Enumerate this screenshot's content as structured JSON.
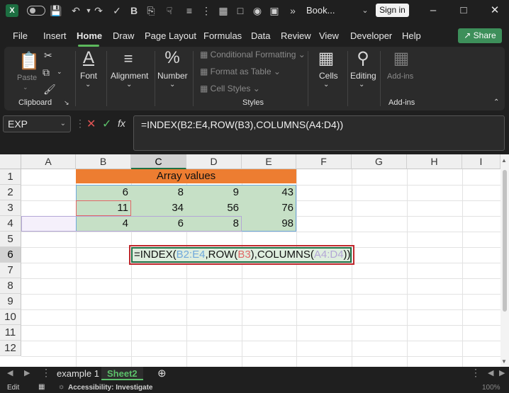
{
  "titlebar": {
    "doc_title": "Book...",
    "sign_in": "Sign in"
  },
  "menu": {
    "tabs": [
      "File",
      "Insert",
      "Home",
      "Draw",
      "Page Layout",
      "Formulas",
      "Data",
      "Review",
      "View",
      "Developer",
      "Help"
    ],
    "active_tab": "Home",
    "share": "Share"
  },
  "ribbon": {
    "paste": "Paste",
    "clipboard": "Clipboard",
    "font": "Font",
    "alignment": "Alignment",
    "number": "Number",
    "conditional_formatting": "Conditional Formatting",
    "format_as_table": "Format as Table",
    "cell_styles": "Cell Styles",
    "styles": "Styles",
    "cells": "Cells",
    "editing": "Editing",
    "add_ins_button": "Add-ins",
    "add_ins_group": "Add-ins"
  },
  "formula_bar": {
    "name_box": "EXP",
    "fx": "fx",
    "formula": "=INDEX(B2:E4,ROW(B3),COLUMNS(A4:D4))"
  },
  "grid": {
    "columns": [
      "A",
      "B",
      "C",
      "D",
      "E",
      "F",
      "G",
      "H",
      "I"
    ],
    "rows": [
      "1",
      "2",
      "3",
      "4",
      "5",
      "6",
      "7",
      "8",
      "9",
      "10",
      "11",
      "12"
    ],
    "banner": "Array values",
    "values": [
      [
        "6",
        "8",
        "9",
        "43"
      ],
      [
        "11",
        "34",
        "56",
        "76"
      ],
      [
        "4",
        "6",
        "8",
        "98"
      ]
    ],
    "edit_cell": {
      "p1": "=INDEX(",
      "r1": "B2:E4",
      "p2": ",ROW(",
      "r2": "B3",
      "p3": "),COLUMNS(",
      "r3": "A4:D4",
      "p4": "))"
    }
  },
  "sheets": {
    "tabs": [
      "example 1",
      "Sheet2"
    ],
    "active": "Sheet2"
  },
  "status": {
    "mode": "Edit",
    "accessibility": "Accessibility: Investigate",
    "zoom": "100%"
  },
  "colors": {
    "banner": "#ed7d31",
    "array_fill": "#c6e0c6",
    "highlight_box": "#c0282d",
    "accent": "#5cb85c"
  }
}
